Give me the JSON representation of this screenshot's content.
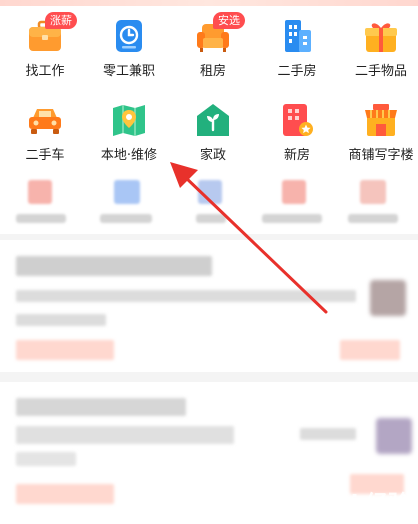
{
  "categories": [
    {
      "label": "找工作",
      "icon": "briefcase-icon",
      "badge": "涨薪"
    },
    {
      "label": "零工兼职",
      "icon": "clock-icon"
    },
    {
      "label": "租房",
      "icon": "sofa-icon",
      "badge": "安选"
    },
    {
      "label": "二手房",
      "icon": "building-icon"
    },
    {
      "label": "二手物品",
      "icon": "gift-box-icon"
    },
    {
      "label": "二手车",
      "icon": "car-icon"
    },
    {
      "label": "本地·维修",
      "icon": "map-pin-icon"
    },
    {
      "label": "家政",
      "icon": "house-sprout-icon"
    },
    {
      "label": "新房",
      "icon": "new-house-icon"
    },
    {
      "label": "商铺写字楼",
      "icon": "shop-icon"
    }
  ],
  "watermark": {
    "text": "Bai 经验",
    "url": "jingyan.baidu.com"
  },
  "colors": {
    "accent": "#ff4d4f",
    "arrow": "#e8312b",
    "background": "#f4f4f4"
  }
}
